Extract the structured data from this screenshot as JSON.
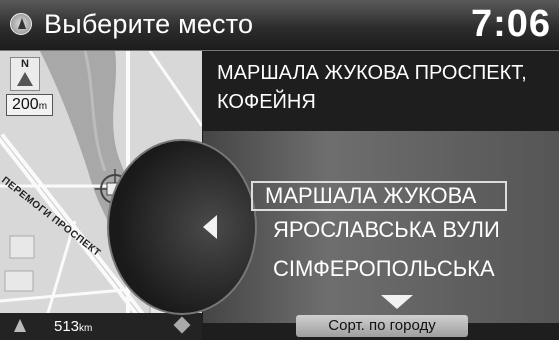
{
  "header": {
    "title": "Выберите место",
    "clock": "7:06",
    "back_icon": "compass-back-icon"
  },
  "map": {
    "scale": "200",
    "scale_unit": "m",
    "north_label": "N",
    "street_label": "ПЕРЕМОГИ ПРОСПЕКТ",
    "distance": "513",
    "distance_unit": "km"
  },
  "detail": {
    "address_line1": "МАРШАЛА ЖУКОВА ПРОСПЕКТ,",
    "address_line2": "КОФЕЙНЯ"
  },
  "list": {
    "items": [
      {
        "label": "МАРШАЛА ЖУКОВА",
        "selected": true
      },
      {
        "label": "ЯРОСЛАВСЬКА ВУЛИ",
        "selected": false
      },
      {
        "label": "СІМФЕРОПОЛЬСЬКА",
        "selected": false
      }
    ]
  },
  "sort_button": {
    "label": "Сорт. по городу"
  }
}
